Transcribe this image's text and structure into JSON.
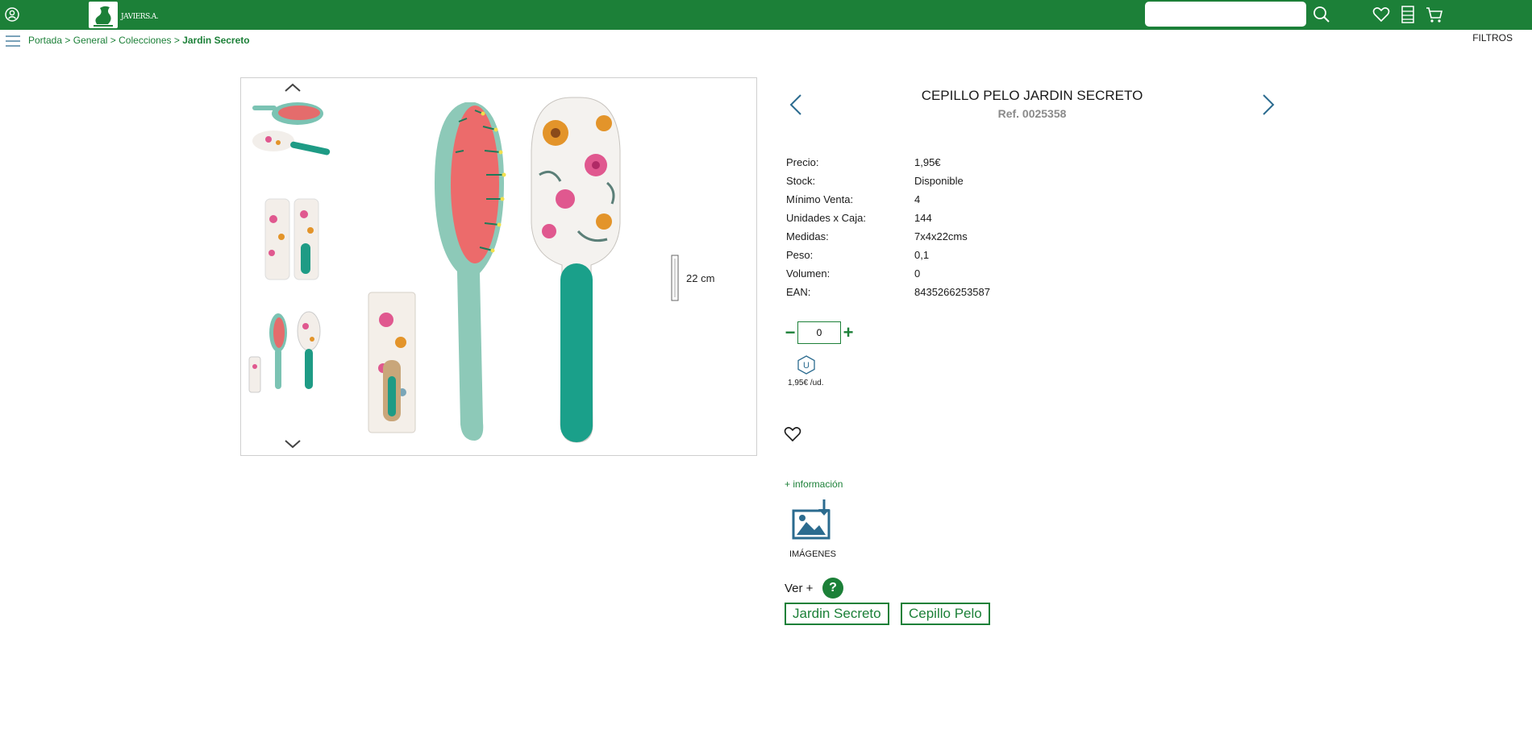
{
  "header": {
    "logo_text": "JAVIER",
    "logo_suffix": "S.A.",
    "search": {
      "placeholder": "",
      "value": ""
    },
    "icons": [
      "user-icon",
      "search-icon",
      "heart-icon",
      "list-icon",
      "cart-icon"
    ],
    "brand_color": "#1c8038"
  },
  "breadcrumb": {
    "items": [
      "Portada",
      "General",
      "Colecciones"
    ],
    "separator": ">",
    "current": "Jardin Secreto"
  },
  "filters_label": "FILTROS",
  "gallery": {
    "dimension_label": "22 cm"
  },
  "product": {
    "title": "CEPILLO PELO JARDIN SECRETO",
    "ref": "Ref. 0025358",
    "specs": [
      {
        "label": "Precio:",
        "value": "1,95€"
      },
      {
        "label": "Stock:",
        "value": "Disponible"
      },
      {
        "label": "Mínimo Venta:",
        "value": "4"
      },
      {
        "label": "Unidades x Caja:",
        "value": "144"
      },
      {
        "label": "Medidas:",
        "value": "7x4x22cms"
      },
      {
        "label": "Peso:",
        "value": "0,1"
      },
      {
        "label": "Volumen:",
        "value": "0"
      },
      {
        "label": "EAN:",
        "value": "8435266253587"
      }
    ],
    "quantity": "0",
    "qty_minus": "−",
    "qty_plus": "+",
    "unit_letter": "U",
    "unit_price": "1,95€ /ud.",
    "more_info": "+ información",
    "images_label": "IMÁGENES",
    "ver_mas": "Ver +",
    "help": "?",
    "tags": [
      "Jardin Secreto",
      "Cepillo Pelo"
    ]
  }
}
